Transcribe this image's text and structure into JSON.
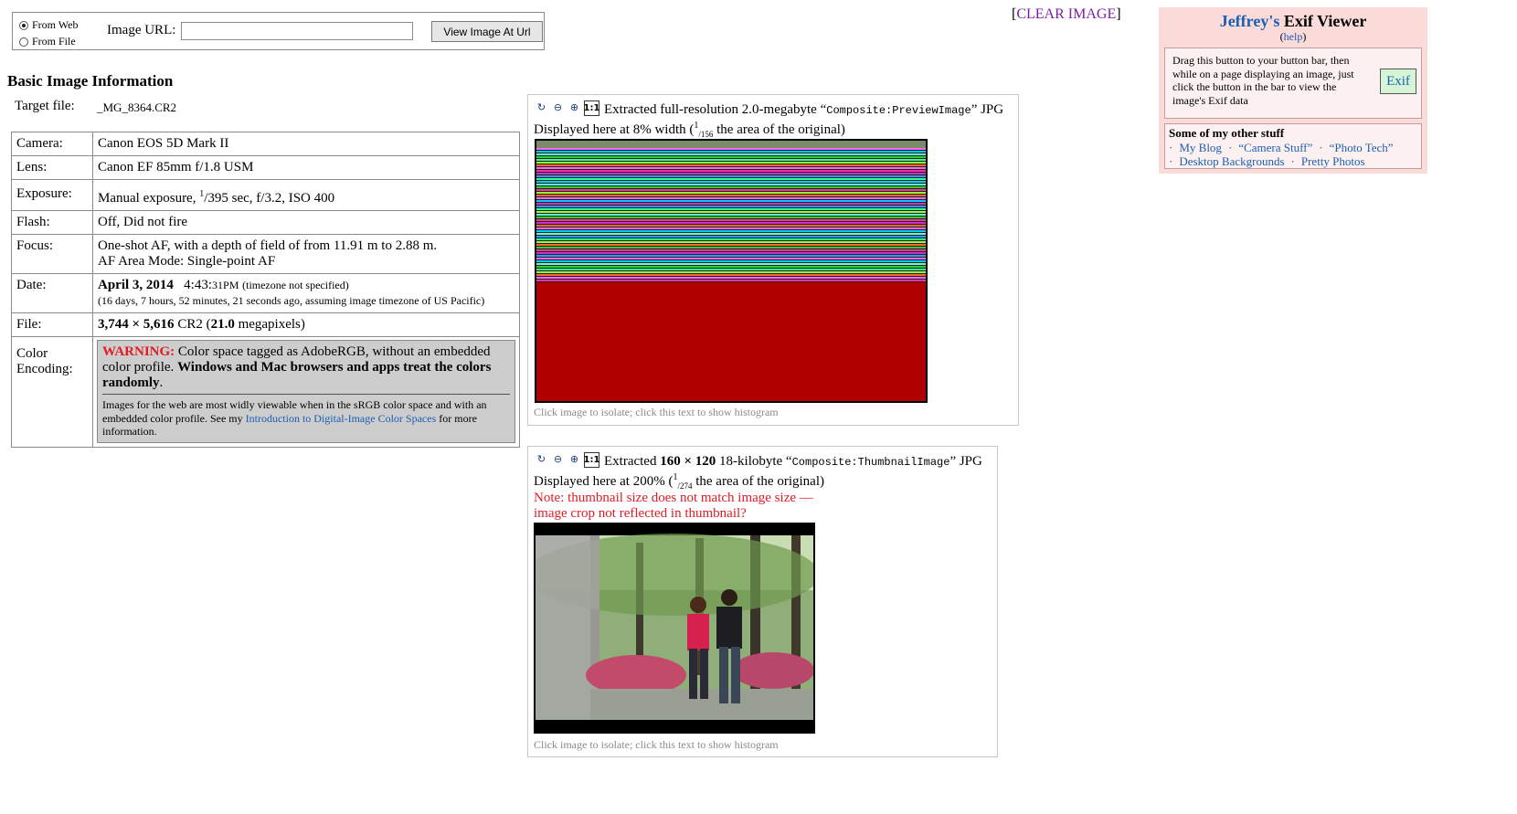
{
  "form": {
    "radio_web": "From Web",
    "radio_file": "From File",
    "url_label": "Image URL:",
    "url_value": "",
    "view_button": "View Image At Url",
    "clear_open": "[",
    "clear_link": "CLEAR IMAGE",
    "clear_close": "]"
  },
  "side": {
    "title_name": "Jeffrey's",
    "title_rest": "Exif Viewer",
    "help_open": "(",
    "help_link": "help",
    "help_close": ")",
    "drag_text": "Drag this button to your button bar, then while on a page displaying an image, just click the button in the bar to view the image's Exif data",
    "exif_button": "Exif",
    "other_title": "Some of my other stuff",
    "links": [
      "My Blog",
      "“Camera Stuff”",
      "“Photo Tech”",
      "Desktop Backgrounds",
      "Pretty Photos"
    ]
  },
  "basic": {
    "title": "Basic Image Information",
    "target_label": "Target file:",
    "target_value": "_MG_8364.CR2"
  },
  "info": {
    "camera_label": "Camera:",
    "camera_value": "Canon EOS 5D Mark II",
    "lens_label": "Lens:",
    "lens_value": "Canon EF 85mm f/1.8 USM",
    "exposure_label": "Exposure:",
    "exposure_pre": "Manual exposure, ",
    "exposure_num": "1",
    "exposure_post": "/395 sec, f/3.2, ISO 400",
    "flash_label": "Flash:",
    "flash_value": "Off, Did not fire",
    "focus_label": "Focus:",
    "focus_line1": "One-shot AF, with a depth of field of from 11.91 m to 2.88 m.",
    "focus_line2": "AF Area Mode: Single-point AF",
    "date_label": "Date:",
    "date_bold": "April 3, 2014",
    "date_time": "4:43:",
    "date_time_small": "31PM",
    "date_tz": "(timezone not specified)",
    "date_ago": "(16 days, 7 hours, 52 minutes, 21 seconds ago, assuming image timezone of US Pacific)",
    "file_label": "File:",
    "file_dims": "3,744 × 5,616",
    "file_type": "CR2",
    "file_open": "(",
    "file_mp": "21.0",
    "file_mp_label": "megapixels)",
    "color_label": "Color Encoding:",
    "warn_head": "WARNING:",
    "warn_text": "Color space tagged as AdobeRGB, without an embedded color profile.",
    "warn_bold": "Windows and Mac browsers and apps treat the colors randomly",
    "warn_end": ".",
    "warn_foot_pre": "Images for the web are most widly viewable when in the sRGB color space and with an embedded color profile. See my",
    "warn_foot_link": "Introduction to Digital-Image Color Spaces",
    "warn_foot_post": "for more information."
  },
  "panel1": {
    "extracted_pre": "Extracted full-resolution 2.0-megabyte “",
    "tag": "Composite:PreviewImage",
    "extracted_post": "” JPG",
    "displayed_pre": "Displayed here at 8% width (",
    "frac_num": "1",
    "frac_den": "/156",
    "displayed_post": " the area of the original)",
    "footer": "Click image to isolate; click this text to show histogram"
  },
  "panel2": {
    "extracted_pre": "Extracted ",
    "dims": "160 × 120",
    "size": " 18-kilobyte “",
    "tag": "Composite:ThumbnailImage",
    "extracted_post": "” JPG",
    "displayed_pre": "Displayed here at 200% (",
    "frac_num": "1",
    "frac_den": "/274",
    "displayed_post": " the area of the original)",
    "note": "Note: thumbnail size does not match image size — image crop not reflected in thumbnail?",
    "footer": "Click image to isolate; click this text to show histogram"
  },
  "tools": {
    "one_to_one": "1:1"
  },
  "colors": {
    "link": "#1a5fb4",
    "warning": "#e01b24",
    "panel_bg": "#fbdada",
    "preview_red": "#b00000"
  }
}
